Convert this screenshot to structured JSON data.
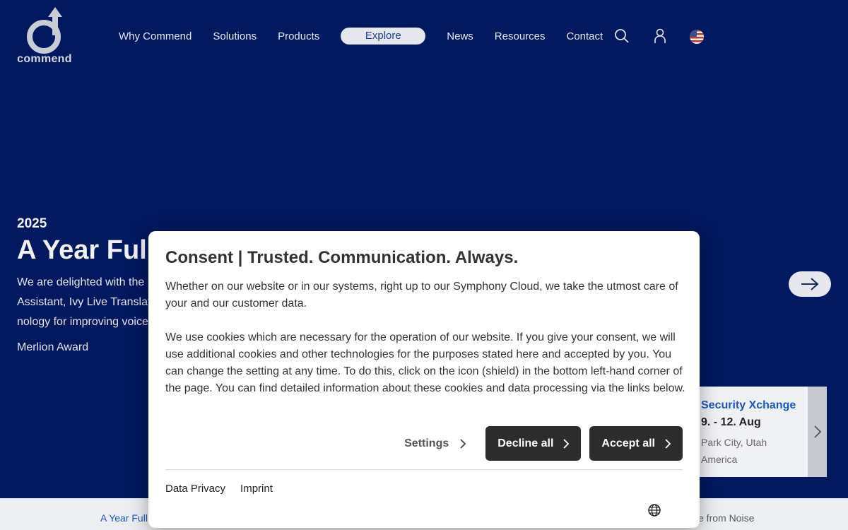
{
  "header": {
    "logo_text": "commend",
    "nav": [
      "Why Commend",
      "Solutions",
      "Products"
    ],
    "nav_explore": "Explore",
    "nav_right": [
      "News",
      "Resources",
      "Contact"
    ],
    "icons": [
      "search-icon",
      "user-icon",
      "us-flag-icon"
    ]
  },
  "hero": {
    "year": "2025",
    "title": "A Year Full",
    "lines": [
      "We are delighted with the",
      "Assistant, Ivy Live Translat",
      "nology for improving voice"
    ],
    "award": "Merlion Award"
  },
  "event": {
    "title": "Security Xchange",
    "date": "9. - 12. Aug",
    "place": "Park City, Utah America"
  },
  "bottom_tabs": {
    "left": "A Year Full",
    "right": "e from Noise"
  },
  "consent": {
    "title": "Consent | Trusted. Communication. Always.",
    "paragraph1": "Whether on our website or in our systems, right up to our Symphony Cloud, we take the utmost care of your and our customer data.",
    "paragraph2": "We use cookies which are necessary for the operation of our website. If you give your consent, we will use additional cookies and other technologies for the purposes stated here and accepted by you. You can change the setting at any time. To do this, click on the icon (shield) in the bottom left-hand corner of the page. You can find detailed information about these cookies and data processing via the links below.",
    "settings_label": "Settings",
    "decline_label": "Decline all",
    "accept_label": "Accept all",
    "links": [
      "Data Privacy",
      "Imprint"
    ]
  },
  "colors": {
    "background": "#02185f",
    "accent_link": "#1d55c6",
    "button_dark": "#2c2c2c"
  }
}
